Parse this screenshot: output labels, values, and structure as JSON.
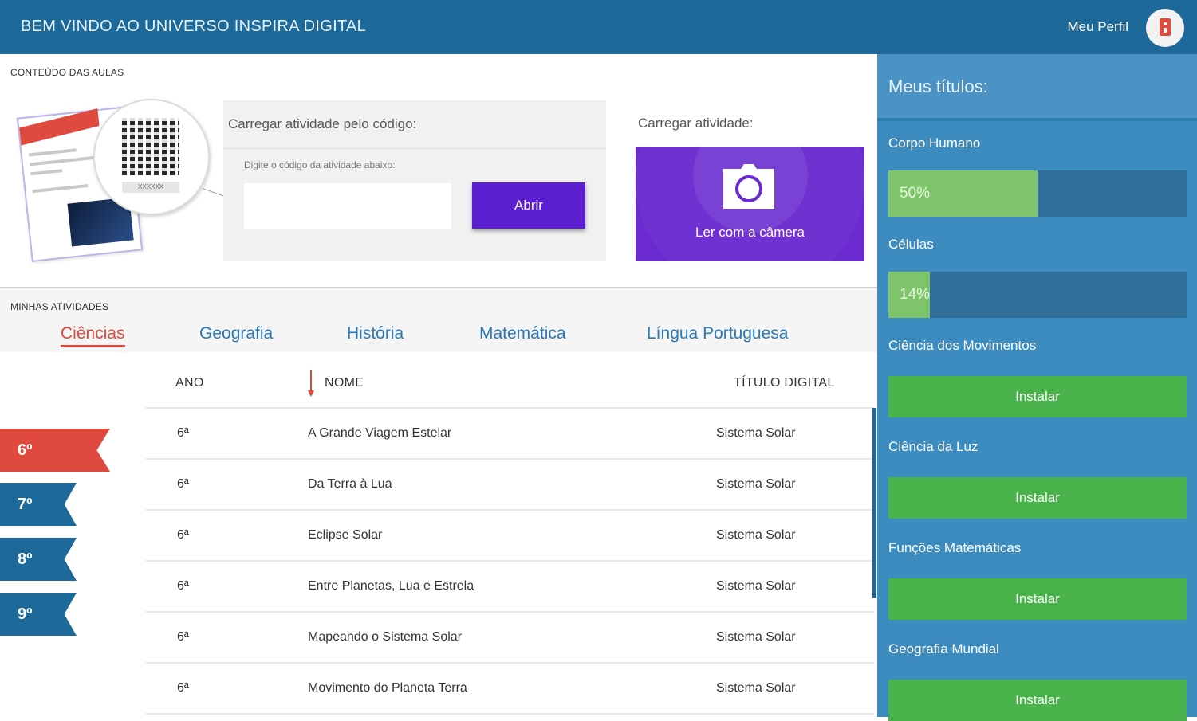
{
  "header": {
    "title": "BEM VINDO AO UNIVERSO INSPIRA DIGITAL",
    "profile_label": "Meu Perfil"
  },
  "lesson_content": {
    "section_label": "CONTEÚDO DAS AULAS",
    "illustration_code": "XXXXXX",
    "code_card": {
      "title": "Carregar atividade pelo código:",
      "hint": "Digite o código da atividade abaixo:",
      "input_value": "",
      "open_label": "Abrir"
    },
    "camera": {
      "label": "Carregar atividade:",
      "button_label": "Ler com a câmera"
    }
  },
  "activities": {
    "section_label": "MINHAS ATIVIDADES",
    "tabs": [
      {
        "label": "Ciências",
        "active": true
      },
      {
        "label": "Geografia",
        "active": false
      },
      {
        "label": "História",
        "active": false
      },
      {
        "label": "Matemática",
        "active": false
      },
      {
        "label": "Língua Portuguesa",
        "active": false
      }
    ],
    "grades": [
      {
        "label": "6º",
        "active": true
      },
      {
        "label": "7º",
        "active": false
      },
      {
        "label": "8º",
        "active": false
      },
      {
        "label": "9º",
        "active": false
      }
    ],
    "columns": {
      "ano": "ANO",
      "nome": "NOME",
      "titulo": "TÍTULO DIGITAL"
    },
    "rows": [
      {
        "ano": "6ª",
        "nome": "A Grande Viagem Estelar",
        "titulo": "Sistema Solar"
      },
      {
        "ano": "6ª",
        "nome": "Da Terra à Lua",
        "titulo": "Sistema Solar"
      },
      {
        "ano": "6ª",
        "nome": "Eclipse Solar",
        "titulo": "Sistema Solar"
      },
      {
        "ano": "6ª",
        "nome": "Entre Planetas, Lua e Estrela",
        "titulo": "Sistema Solar"
      },
      {
        "ano": "6ª",
        "nome": "Mapeando o Sistema Solar",
        "titulo": "Sistema Solar"
      },
      {
        "ano": "6ª",
        "nome": "Movimento do Planeta Terra",
        "titulo": "Sistema Solar"
      }
    ]
  },
  "sidebar": {
    "title": "Meus títulos:",
    "items": [
      {
        "name": "Corpo Humano",
        "progress": "50%",
        "progress_value": 0.5
      },
      {
        "name": "Células",
        "progress": "14%",
        "progress_value": 0.14
      },
      {
        "name": "Ciência dos Movimentos",
        "action": "Instalar"
      },
      {
        "name": "Ciência da Luz",
        "action": "Instalar"
      },
      {
        "name": "Funções Matemáticas",
        "action": "Instalar"
      },
      {
        "name": "Geografia Mundial",
        "action": "Instalar"
      }
    ]
  },
  "colors": {
    "header": "#1d6a9a",
    "accent_red": "#e0493d",
    "purple": "#5b1fcf",
    "tab_blue": "#2a79b5",
    "sidebar": "#3d8cc0",
    "install_green": "#4ab24a",
    "progress_green": "#7ec46a"
  },
  "icons": {
    "profile": "id-badge-icon",
    "camera": "camera-icon",
    "sort": "sort-down-icon"
  }
}
